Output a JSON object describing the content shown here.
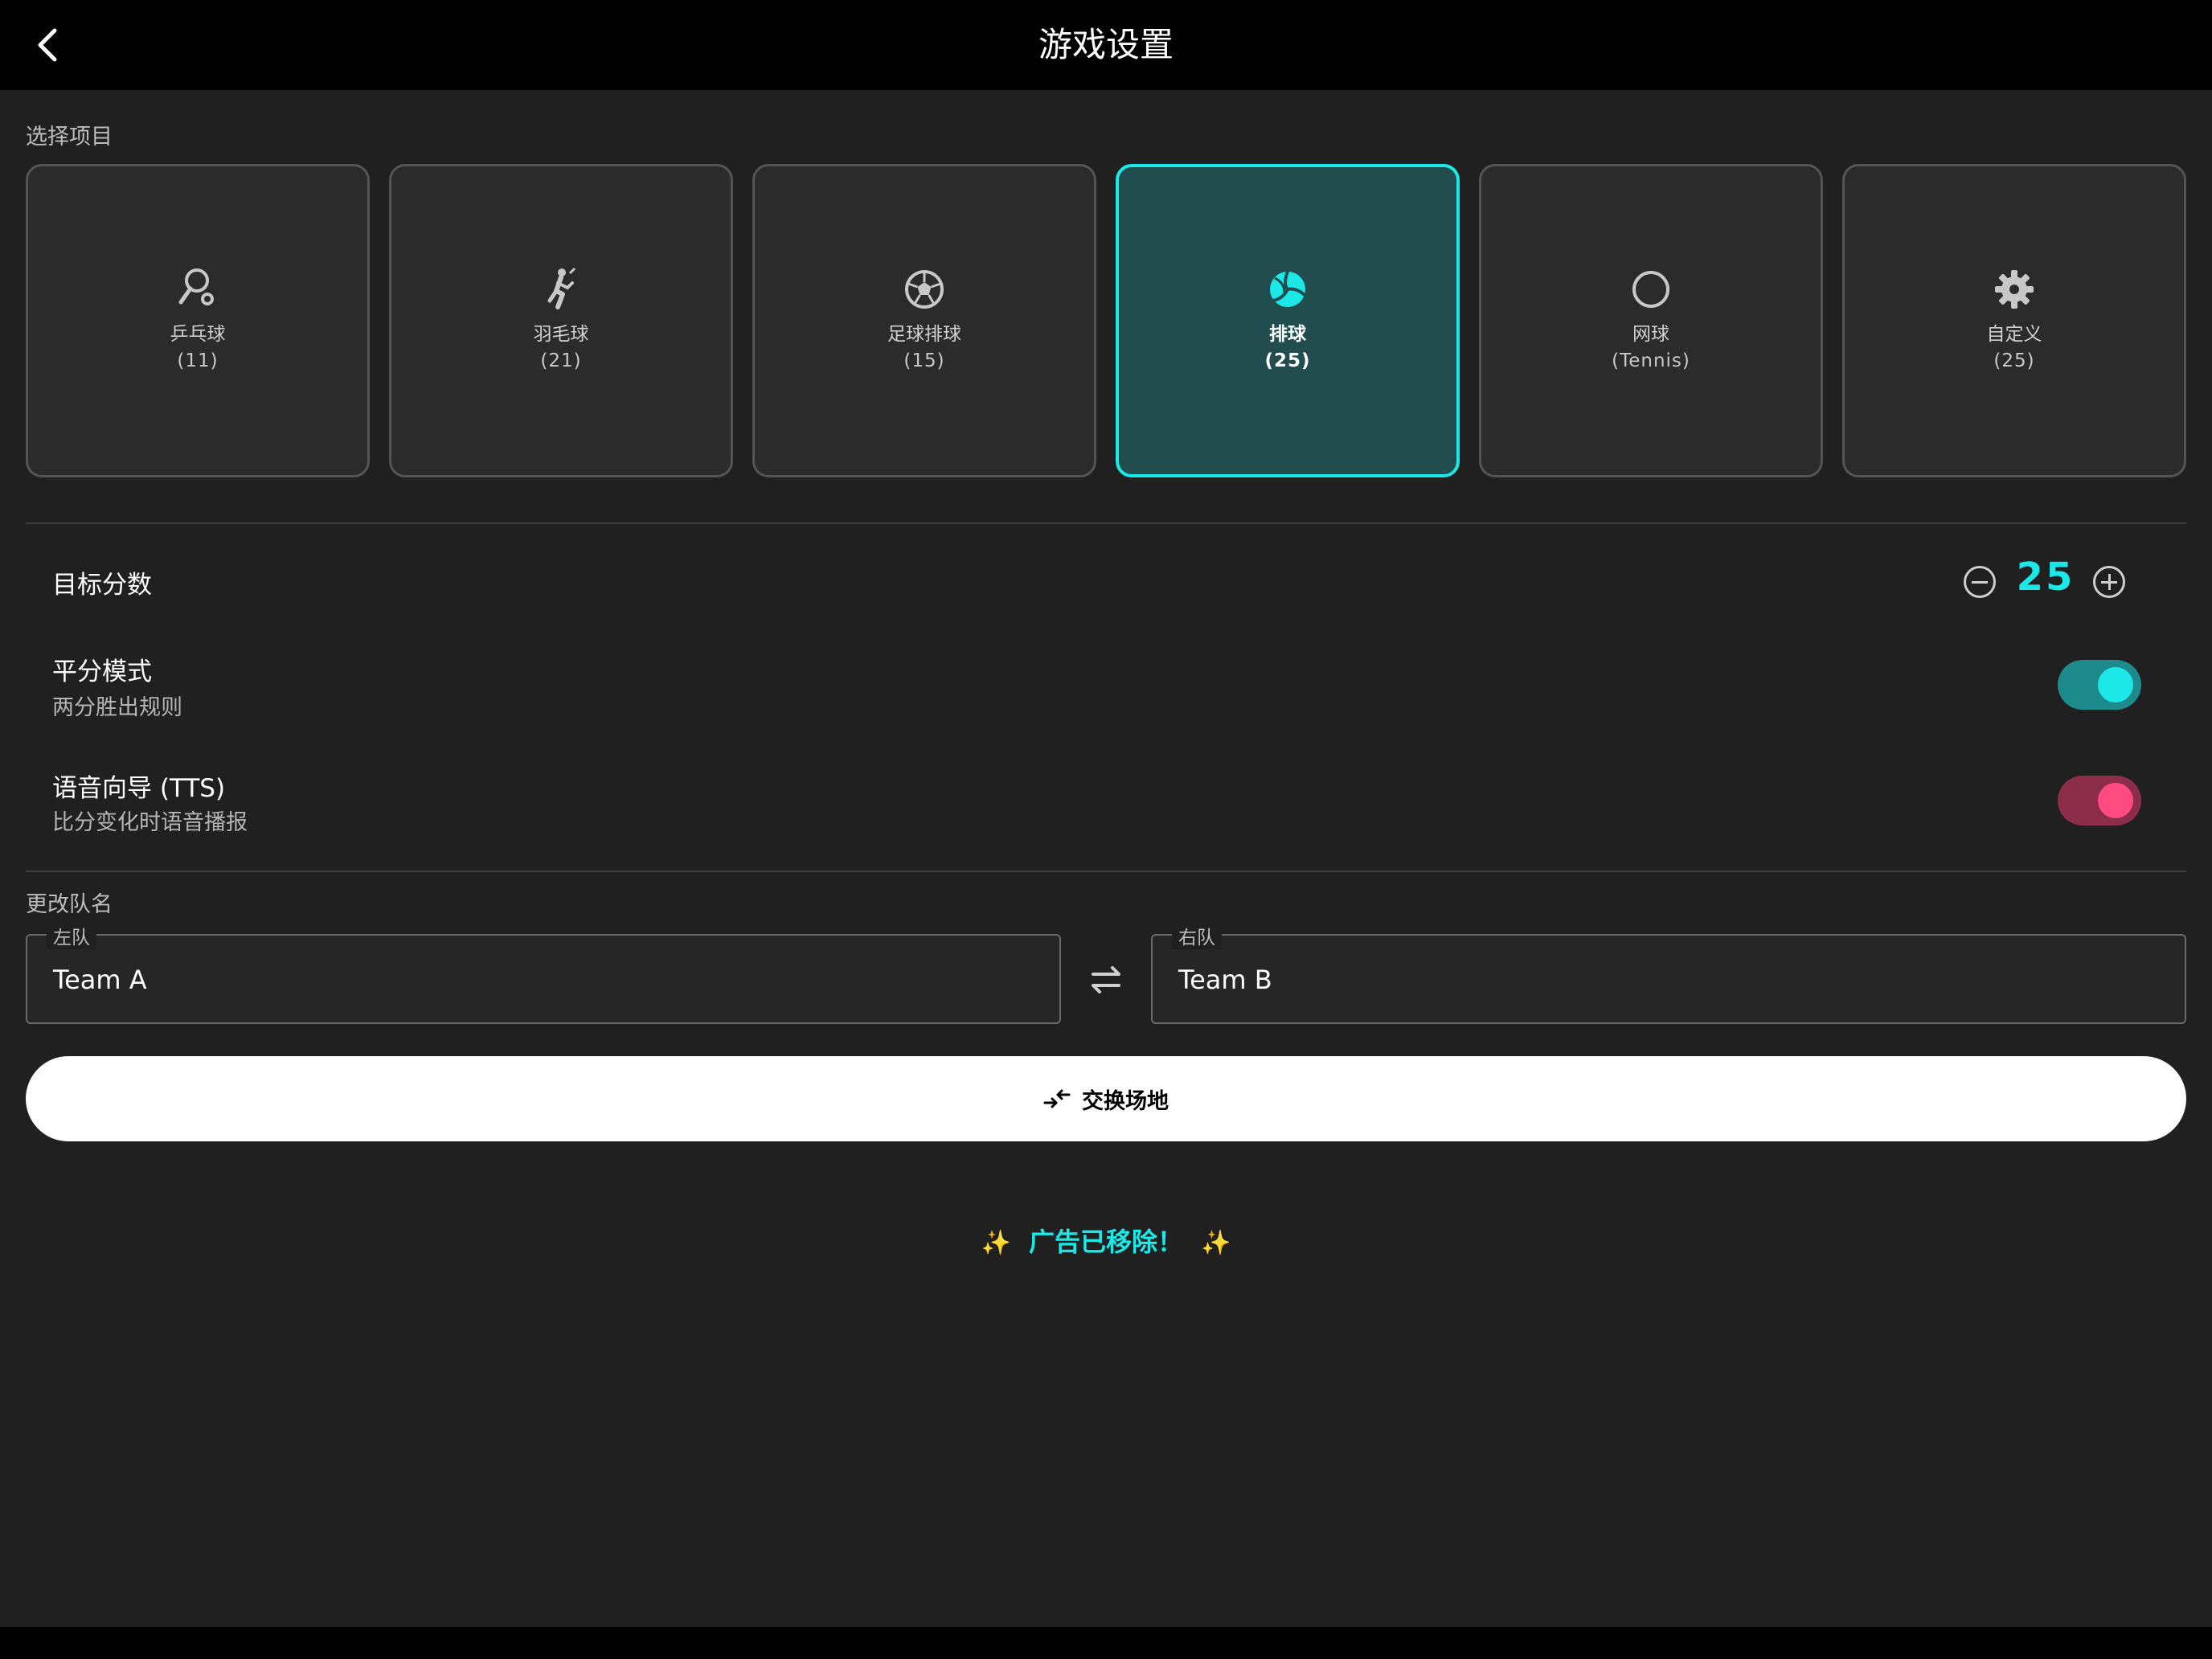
{
  "header": {
    "title": "游戏设置"
  },
  "sports_section": {
    "label": "选择项目",
    "sports": [
      {
        "name": "乒乓球",
        "points": "(11)",
        "icon": "table-tennis-icon"
      },
      {
        "name": "羽毛球",
        "points": "(21)",
        "icon": "badminton-icon"
      },
      {
        "name": "足球排球",
        "points": "(15)",
        "icon": "soccer-ball-icon"
      },
      {
        "name": "排球",
        "points": "(25)",
        "icon": "volleyball-icon"
      },
      {
        "name": "网球",
        "points": "(Tennis)",
        "icon": "circle-icon"
      },
      {
        "name": "自定义",
        "points": "(25)",
        "icon": "gear-icon"
      }
    ],
    "selected_index": 3
  },
  "target_score": {
    "label": "目标分数",
    "value": "25"
  },
  "deuce_mode": {
    "title": "平分模式",
    "subtitle": "两分胜出规则",
    "on": true,
    "color": "#1ce8e8"
  },
  "tts": {
    "title": "语音向导 (TTS)",
    "subtitle": "比分变化时语音播报",
    "on": true,
    "color": "#ff4a82"
  },
  "team_names": {
    "label": "更改队名",
    "left": {
      "label": "左队",
      "value": "Team A"
    },
    "right": {
      "label": "右队",
      "value": "Team B"
    }
  },
  "swap_court_button": {
    "label": "交换场地"
  },
  "ad_notice": {
    "text": "广告已移除！",
    "sparkle": "✨"
  },
  "colors": {
    "accent": "#1ce8e8",
    "pink": "#ff4a82",
    "background": "#202020"
  }
}
